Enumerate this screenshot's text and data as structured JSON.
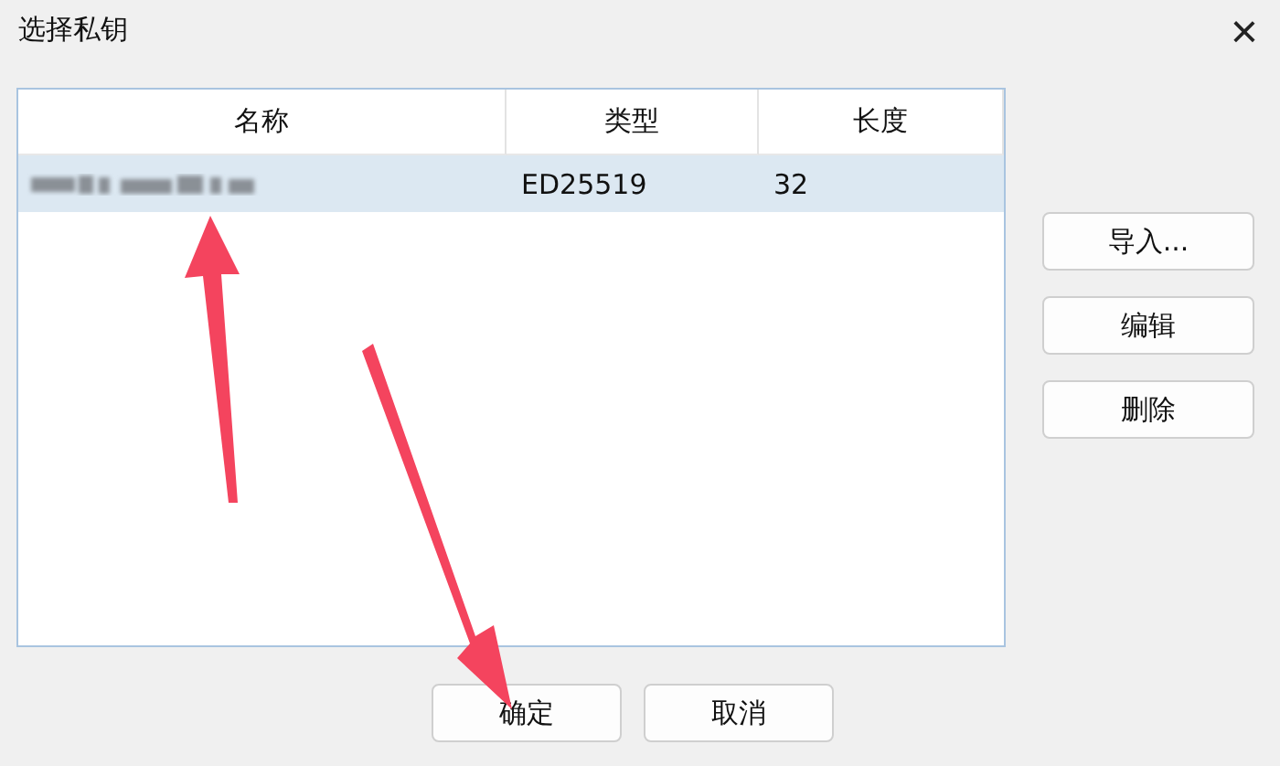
{
  "window": {
    "title": "选择私钥",
    "close": "×"
  },
  "table": {
    "columns": [
      "名称",
      "类型",
      "长度"
    ],
    "rows": [
      {
        "name_hidden": true,
        "type": "ED25519",
        "length": "32",
        "selected": true
      }
    ]
  },
  "side_buttons": [
    "导入...",
    "编辑",
    "删除"
  ],
  "buttons": [
    "确定",
    "取消"
  ]
}
